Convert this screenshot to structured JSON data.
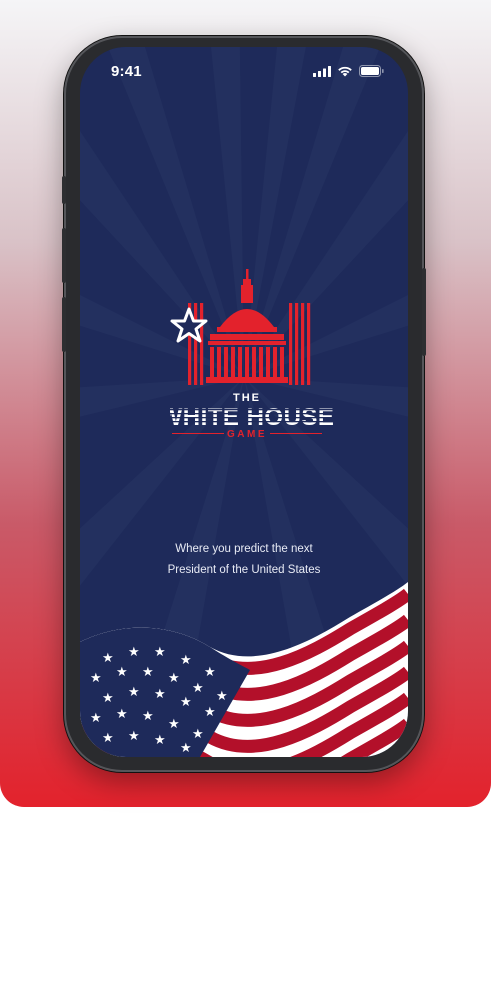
{
  "status_bar": {
    "time": "9:41"
  },
  "logo": {
    "line1": "THE",
    "line2": "WHITE HOUSE",
    "line3": "GAME"
  },
  "tagline": {
    "line1": "Where you predict the next",
    "line2": "President of the United States"
  },
  "colors": {
    "navy": "#1e2a5a",
    "red": "#e3222c",
    "white": "#ffffff",
    "flag_red": "#b3102a"
  },
  "icons": [
    "signal-icon",
    "wifi-icon",
    "battery-icon",
    "capitol-dome-icon",
    "star-icon",
    "us-flag-icon"
  ]
}
